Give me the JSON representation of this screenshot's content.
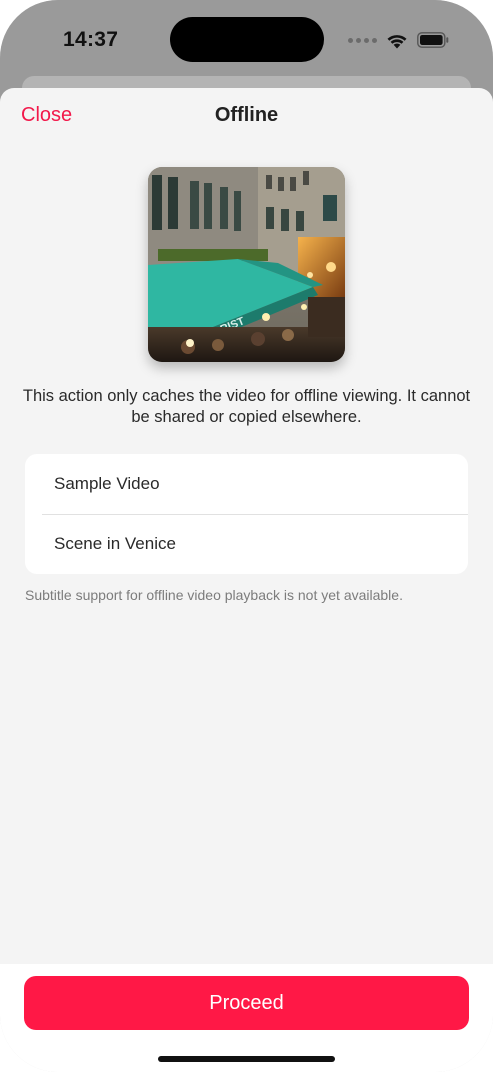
{
  "status_bar": {
    "time": "14:37",
    "icons": [
      "signal-dots-icon",
      "wifi-icon",
      "battery-icon"
    ]
  },
  "header": {
    "close_label": "Close",
    "title": "Offline"
  },
  "thumbnail": {
    "icon": "venice-video-thumbnail",
    "sign_text": "RIST"
  },
  "description": "This action only caches the video for offline viewing. It cannot be shared or copied elsewhere.",
  "info_rows": [
    {
      "label": "Sample Video"
    },
    {
      "label": "Scene in Venice"
    }
  ],
  "footnote": "Subtitle support for offline video playback is not yet available.",
  "footer": {
    "proceed_label": "Proceed"
  },
  "colors": {
    "accent": "#F2184A",
    "button": "#FF1846",
    "sheet_background": "#F4F4F4"
  }
}
